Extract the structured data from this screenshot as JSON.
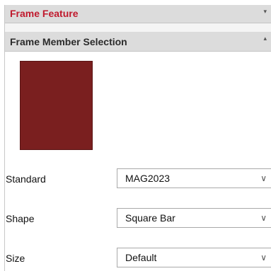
{
  "colors": {
    "accent_red": "#c0192d",
    "swatch": "#7a1f1f",
    "header_bg": "#dcdcdc"
  },
  "frame_feature": {
    "title": "Frame Feature",
    "chevron_icon": "chevron-down-icon",
    "chevron": "▾"
  },
  "member_selection": {
    "title": "Frame Member Selection",
    "chevron_icon": "chevron-up-icon",
    "chevron": "▴"
  },
  "fields": {
    "standard": {
      "label": "Standard",
      "value": "MAG2023",
      "arrow": "∨"
    },
    "shape": {
      "label": "Shape",
      "value": "Square Bar",
      "arrow": "∨"
    },
    "size": {
      "label": "Size",
      "value": "Default",
      "arrow": "∨"
    }
  }
}
